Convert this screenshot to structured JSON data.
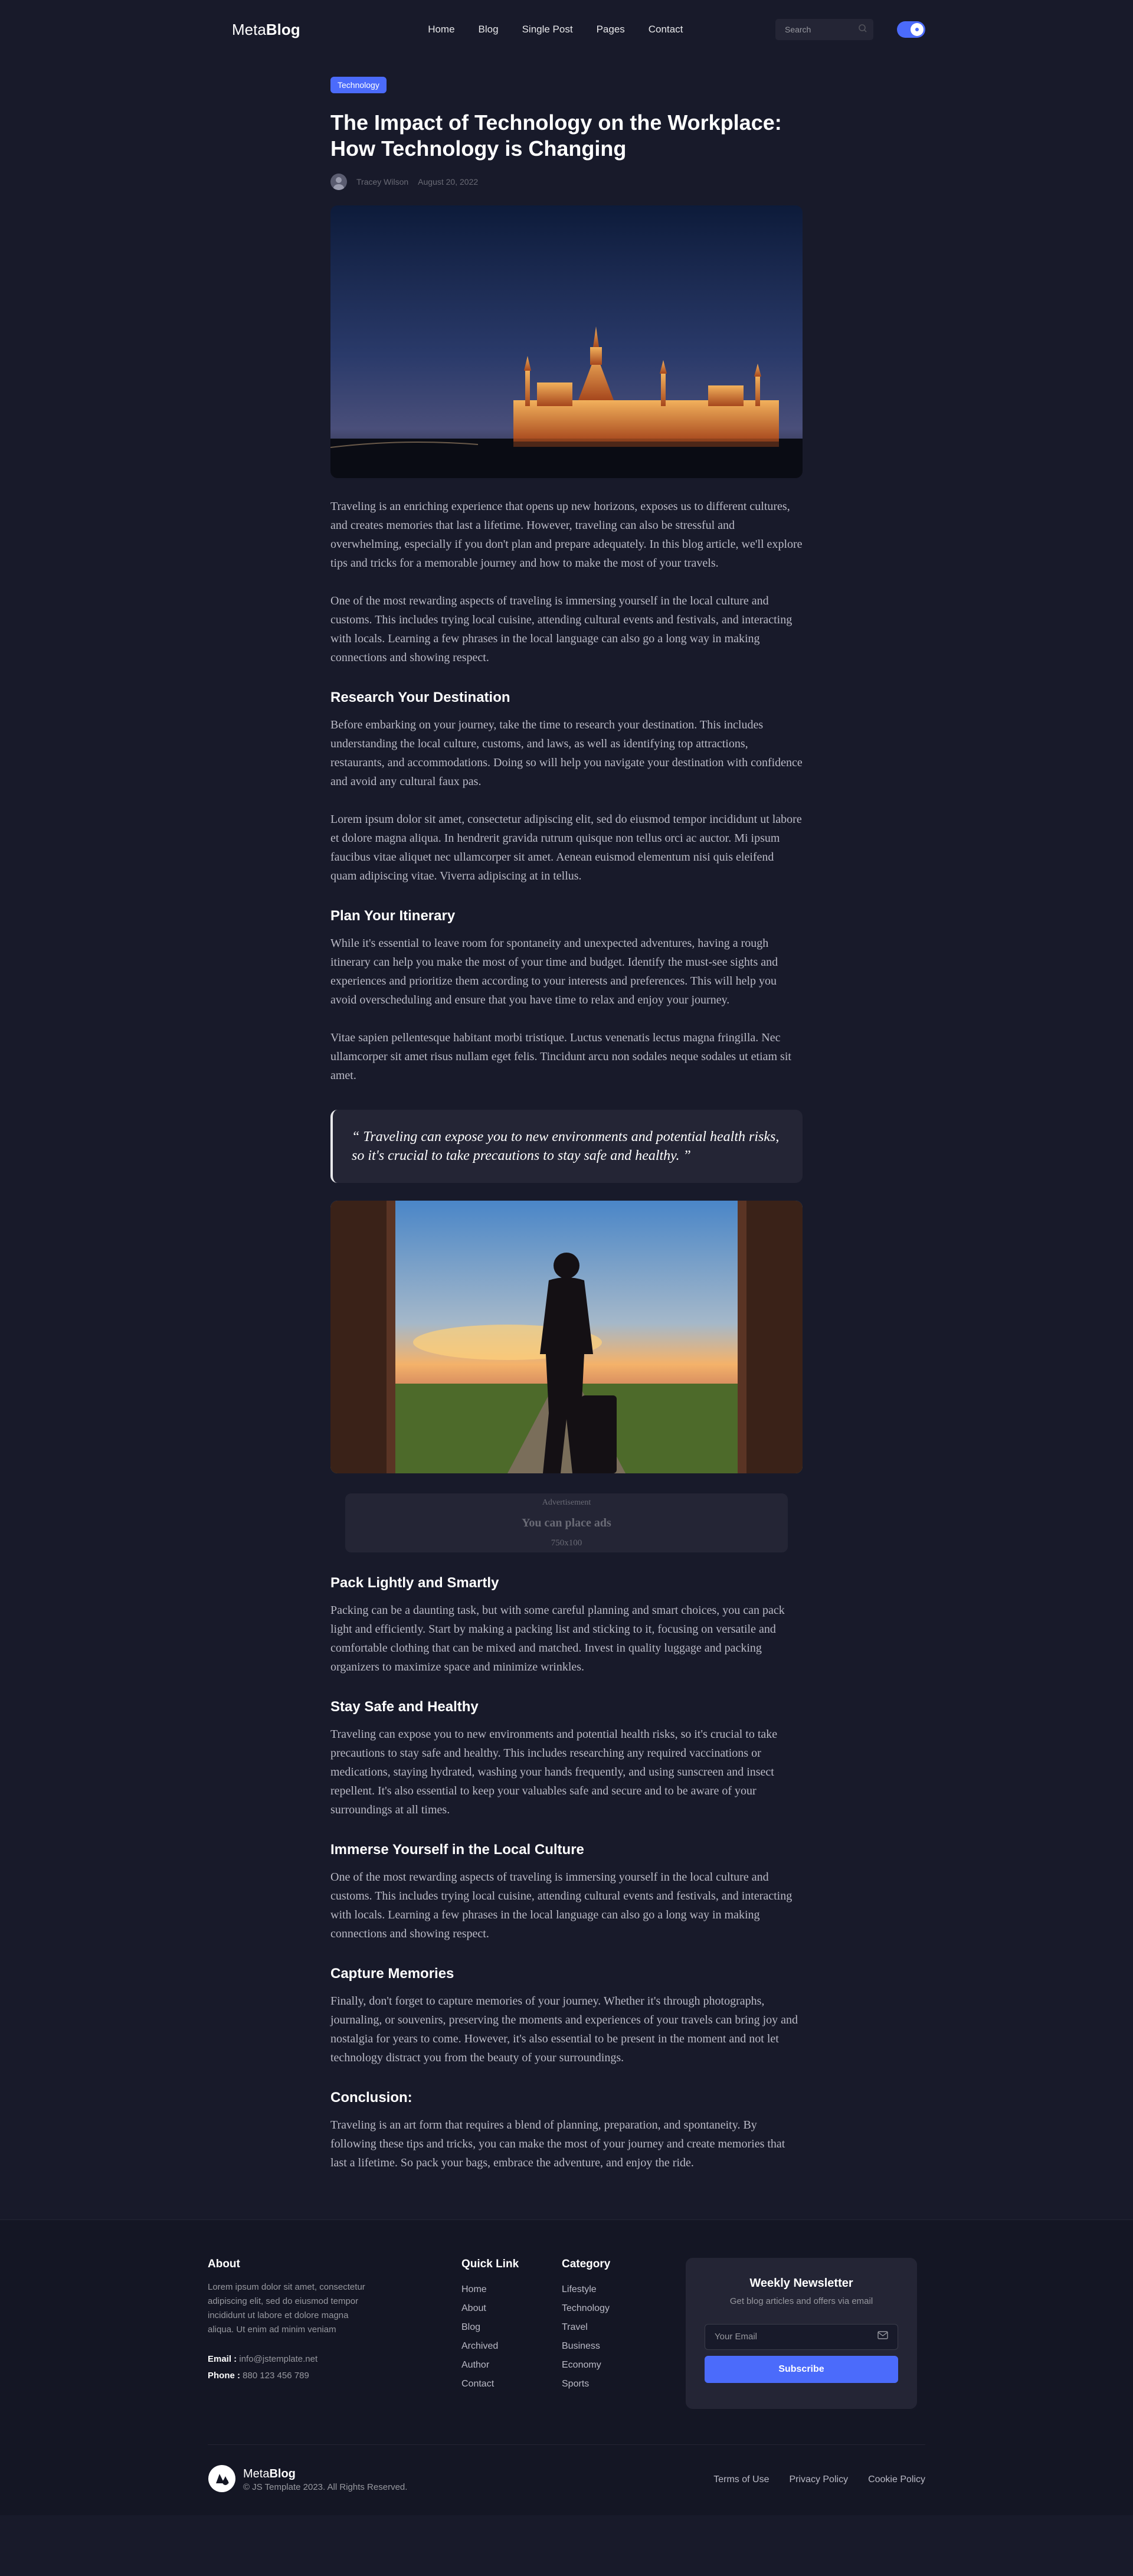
{
  "header": {
    "logo_light": "Meta",
    "logo_bold": "Blog",
    "nav": [
      "Home",
      "Blog",
      "Single Post",
      "Pages",
      "Contact"
    ],
    "search_placeholder": "Search"
  },
  "article": {
    "category": "Technology",
    "title": "The Impact of Technology on the Workplace: How Technology is Changing",
    "author": "Tracey Wilson",
    "date": "August 20, 2022",
    "p1": "Traveling is an enriching experience that opens up new horizons, exposes us to different cultures, and creates memories that last a lifetime. However, traveling can also be stressful and overwhelming, especially if you don't plan and prepare adequately. In this blog article, we'll explore tips and tricks for a memorable journey and how to make the most of your travels.",
    "p2": "One of the most rewarding aspects of traveling is immersing yourself in the local culture and customs. This includes trying local cuisine, attending cultural events and festivals, and interacting with locals. Learning a few phrases in the local language can also go a long way in making connections and showing respect.",
    "h_research": "Research Your Destination",
    "p3": "Before embarking on your journey, take the time to research your destination. This includes understanding the local culture, customs, and laws, as well as identifying top attractions, restaurants, and accommodations. Doing so will help you navigate your destination with confidence and avoid any cultural faux pas.",
    "p4": "Lorem ipsum dolor sit amet, consectetur adipiscing elit, sed do eiusmod tempor incididunt ut labore et dolore magna aliqua. In hendrerit gravida rutrum quisque non tellus orci ac auctor. Mi ipsum faucibus vitae aliquet nec ullamcorper sit amet. Aenean euismod elementum nisi quis eleifend quam adipiscing vitae. Viverra adipiscing at in tellus.",
    "h_plan": "Plan Your Itinerary",
    "p5": "While it's essential to leave room for spontaneity and unexpected adventures, having a rough itinerary can help you make the most of your time and budget. Identify the must-see sights and experiences and prioritize them according to your interests and preferences. This will help you avoid overscheduling and ensure that you have time to relax and enjoy your journey.",
    "p6": "Vitae sapien pellentesque habitant morbi tristique. Luctus venenatis lectus magna fringilla. Nec ullamcorper sit amet risus nullam eget felis. Tincidunt arcu non sodales neque sodales ut etiam sit amet.",
    "quote": "“ Traveling can expose you to new environments and potential health risks, so it's crucial to take precautions to stay safe and healthy. ”",
    "ad_label": "Advertisement",
    "ad_text": "You can place ads",
    "ad_size": "750x100",
    "h_pack": "Pack Lightly and Smartly",
    "p7": "Packing can be a daunting task, but with some careful planning and smart choices, you can pack light and efficiently. Start by making a packing list and sticking to it, focusing on versatile and comfortable clothing that can be mixed and matched. Invest in quality luggage and packing organizers to maximize space and minimize wrinkles.",
    "h_safe": "Stay Safe and Healthy",
    "p8": "Traveling can expose you to new environments and potential health risks, so it's crucial to take precautions to stay safe and healthy. This includes researching any required vaccinations or medications, staying hydrated, washing your hands frequently, and using sunscreen and insect repellent. It's also essential to keep your valuables safe and secure and to be aware of your surroundings at all times.",
    "h_immerse": "Immerse Yourself in the Local Culture",
    "p9": "One of the most rewarding aspects of traveling is immersing yourself in the local culture and customs. This includes trying local cuisine, attending cultural events and festivals, and interacting with locals. Learning a few phrases in the local language can also go a long way in making connections and showing respect.",
    "h_capture": "Capture Memories",
    "p10": "Finally, don't forget to capture memories of your journey. Whether it's through photographs, journaling, or souvenirs, preserving the moments and experiences of your travels can bring joy and nostalgia for years to come. However, it's also essential to be present in the moment and not let technology distract you from the beauty of your surroundings.",
    "h_conclusion": "Conclusion:",
    "p11": "Traveling is an art form that requires a blend of planning, preparation, and spontaneity. By following these tips and tricks, you can make the most of your journey and create memories that last a lifetime. So pack your bags, embrace the adventure, and enjoy the ride."
  },
  "footer": {
    "about_title": "About",
    "about_text": "Lorem ipsum dolor sit amet, consectetur adipiscing elit, sed do eiusmod tempor incididunt ut labore et dolore magna aliqua. Ut enim ad minim veniam",
    "email_label": "Email :",
    "email": "info@jstemplate.net",
    "phone_label": "Phone :",
    "phone": "880 123 456 789",
    "quick_title": "Quick Link",
    "quick_links": [
      "Home",
      "About",
      "Blog",
      "Archived",
      "Author",
      "Contact"
    ],
    "category_title": "Category",
    "categories": [
      "Lifestyle",
      "Technology",
      "Travel",
      "Business",
      "Economy",
      "Sports"
    ],
    "newsletter_title": "Weekly Newsletter",
    "newsletter_sub": "Get blog articles and offers via email",
    "newsletter_placeholder": "Your Email",
    "subscribe": "Subscribe",
    "brand_light": "Meta",
    "brand_bold": "Blog",
    "copyright": "© JS Template 2023. All Rights Reserved.",
    "legal": [
      "Terms of Use",
      "Privacy Policy",
      "Cookie Policy"
    ]
  }
}
